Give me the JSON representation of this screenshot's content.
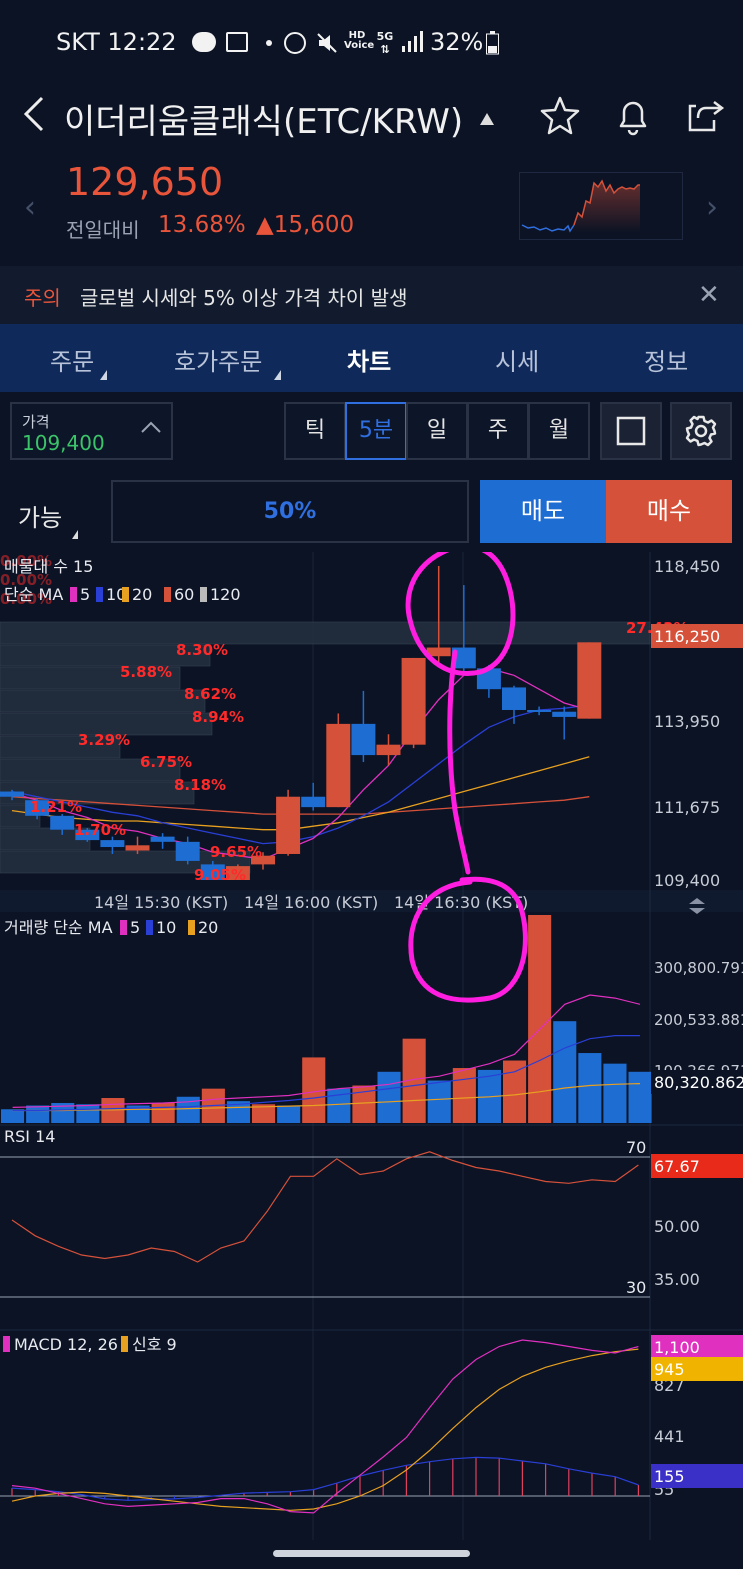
{
  "status": {
    "carrier_time": "SKT 12:22",
    "battery": "32%",
    "icons": [
      "talk-icon",
      "image-icon",
      "dot-icon",
      "alarm-icon",
      "mute-icon",
      "hd-voice-icon",
      "5g-icon",
      "signal-icon",
      "battery-icon"
    ]
  },
  "header": {
    "title": "이더리움클래식(ETC/KRW)",
    "icons": [
      "star-icon",
      "bell-icon",
      "share-icon"
    ]
  },
  "ticker": {
    "price": "129,650",
    "change_label": "전일대비",
    "change_pct": "13.68%",
    "change_amount": "▲15,600"
  },
  "notice": {
    "tag": "주의",
    "text": "글로벌 시세와 5% 이상 가격 차이 발생"
  },
  "tabs": [
    {
      "label": "주문"
    },
    {
      "label": "호가주문"
    },
    {
      "label": "차트"
    },
    {
      "label": "시세"
    },
    {
      "label": "정보"
    }
  ],
  "pricebox": {
    "label": "가격",
    "value": "109,400"
  },
  "periods": [
    "틱",
    "5분",
    "일",
    "주",
    "월"
  ],
  "active_period": "5분",
  "order": {
    "available_label": "가능",
    "percent": "50%",
    "sell_label": "매도",
    "buy_label": "매수"
  },
  "colors": {
    "up": "#d6513a",
    "down": "#1e6dd2",
    "accent_green": "#3cc46a",
    "annotation": "#ff1ee0"
  },
  "chart_data": {
    "type": "candlestick",
    "main_panel": {
      "title": "매물대 수 15",
      "ma_label": "단순 MA",
      "ma_periods": [
        "5",
        "10",
        "20",
        "60",
        "120"
      ],
      "y_ticks": [
        "118,450",
        "116,250",
        "113,950",
        "111,675",
        "109,400"
      ],
      "current_price_tag": "116,250",
      "top_left_labels": [
        "0.00%",
        "0.00%",
        "0.00%"
      ],
      "volume_profile_labels": [
        "8.30%",
        "5.88%",
        "8.62%",
        "8.94%",
        "3.29%",
        "6.75%",
        "8.18%",
        "1.21%",
        "1.70%",
        "9.65%",
        "9.05%"
      ],
      "edge_label": "27.43%",
      "x_ticks": [
        "14일 15:30 (KST)",
        "14일 16:00 (KST)",
        "14일 16:30 (KST)"
      ],
      "candles": [
        {
          "o": 111950,
          "h": 112000,
          "l": 111700,
          "c": 111800
        },
        {
          "o": 111700,
          "h": 111750,
          "l": 111150,
          "c": 111250
        },
        {
          "o": 111250,
          "h": 111300,
          "l": 110700,
          "c": 110850
        },
        {
          "o": 110850,
          "h": 110900,
          "l": 110500,
          "c": 110550
        },
        {
          "o": 110550,
          "h": 110650,
          "l": 110150,
          "c": 110350
        },
        {
          "o": 110250,
          "h": 110650,
          "l": 110150,
          "c": 110400
        },
        {
          "o": 110650,
          "h": 110750,
          "l": 110300,
          "c": 110500
        },
        {
          "o": 110500,
          "h": 110650,
          "l": 109850,
          "c": 109950
        },
        {
          "o": 109850,
          "h": 109950,
          "l": 109400,
          "c": 109400
        },
        {
          "o": 109400,
          "h": 109850,
          "l": 109400,
          "c": 109800
        },
        {
          "o": 109850,
          "h": 110200,
          "l": 109700,
          "c": 110100
        },
        {
          "o": 110150,
          "h": 112000,
          "l": 110100,
          "c": 111800
        },
        {
          "o": 111800,
          "h": 112200,
          "l": 111400,
          "c": 111500
        },
        {
          "o": 111500,
          "h": 114200,
          "l": 111500,
          "c": 113900
        },
        {
          "o": 113900,
          "h": 114850,
          "l": 112800,
          "c": 113000
        },
        {
          "o": 113000,
          "h": 113600,
          "l": 112700,
          "c": 113300
        },
        {
          "o": 113300,
          "h": 115800,
          "l": 113200,
          "c": 115800
        },
        {
          "o": 115850,
          "h": 118450,
          "l": 115600,
          "c": 116100
        },
        {
          "o": 116100,
          "h": 117900,
          "l": 115350,
          "c": 115500
        },
        {
          "o": 115500,
          "h": 115600,
          "l": 114650,
          "c": 114900
        },
        {
          "o": 114950,
          "h": 115000,
          "l": 113900,
          "c": 114300
        },
        {
          "o": 114300,
          "h": 114400,
          "l": 114150,
          "c": 114250
        },
        {
          "o": 114250,
          "h": 114400,
          "l": 113450,
          "c": 114100
        },
        {
          "o": 114050,
          "h": 116250,
          "l": 114050,
          "c": 116250
        }
      ],
      "ma5": [
        111900,
        111700,
        111400,
        111200,
        110900,
        110800,
        110600,
        110450,
        110200,
        110100,
        110000,
        110300,
        110600,
        111200,
        112000,
        112700,
        113700,
        114600,
        115300,
        115500,
        115300,
        114900,
        114500,
        114300
      ],
      "ma10": [
        111950,
        111800,
        111650,
        111500,
        111350,
        111250,
        111050,
        110900,
        110750,
        110600,
        110450,
        110500,
        110650,
        110900,
        111250,
        111650,
        112200,
        112750,
        113300,
        113800,
        114100,
        114300,
        114350,
        114450
      ],
      "ma20": [
        111400,
        111300,
        111200,
        111150,
        111100,
        111100,
        111050,
        111000,
        110950,
        110900,
        110850,
        110850,
        110950,
        111050,
        111200,
        111350,
        111550,
        111750,
        111950,
        112150,
        112350,
        112550,
        112750,
        112950
      ],
      "ma60": [
        111800,
        111750,
        111700,
        111650,
        111600,
        111550,
        111500,
        111450,
        111400,
        111350,
        111300,
        111300,
        111300,
        111300,
        111300,
        111350,
        111400,
        111450,
        111500,
        111550,
        111600,
        111650,
        111700,
        111800
      ]
    },
    "volume_panel": {
      "title": "거래량 단순 MA",
      "ma_periods": [
        "5",
        "10",
        "20"
      ],
      "y_ticks": [
        "300,800.791",
        "200,533.881",
        "100,266.971"
      ],
      "current_tag": "80,320.862",
      "values": [
        22000,
        28000,
        32000,
        30000,
        40000,
        28000,
        32000,
        42000,
        55000,
        35000,
        30000,
        28000,
        105000,
        55000,
        60000,
        82000,
        135000,
        68000,
        88000,
        85000,
        100000,
        333000,
        163000,
        112000,
        95000,
        82000,
        67000,
        48000,
        45000,
        60000,
        68000
      ]
    },
    "rsi_panel": {
      "title": "RSI 14",
      "y_ticks": [
        "70",
        "50.00",
        "35.00",
        "30"
      ],
      "current_tag": "67.67",
      "values": [
        52,
        47.5,
        44.5,
        42,
        41,
        42,
        44,
        43,
        40,
        44,
        46,
        54.5,
        64.5,
        64.5,
        69.5,
        65,
        66,
        69.5,
        71.5,
        69,
        67,
        66,
        64.5,
        63,
        62.5,
        63.5,
        63,
        67.7
      ]
    },
    "macd_panel": {
      "title": "MACD 12, 26",
      "signal_label": "신호 9",
      "y_ticks": [
        "827",
        "441",
        "55"
      ],
      "tags": [
        "1,100",
        "945",
        "155"
      ],
      "macd": [
        80,
        60,
        20,
        -20,
        -60,
        -80,
        -70,
        -60,
        -50,
        -20,
        -20,
        -60,
        -120,
        -130,
        20,
        160,
        300,
        450,
        680,
        900,
        1050,
        1150,
        1200,
        1180,
        1150,
        1120,
        1100,
        1150
      ],
      "signal": [
        -40,
        0,
        20,
        30,
        20,
        0,
        -20,
        -40,
        -60,
        -80,
        -90,
        -100,
        -110,
        -100,
        -60,
        0,
        80,
        200,
        350,
        520,
        680,
        820,
        920,
        990,
        1040,
        1080,
        1110,
        1130
      ],
      "hist": [
        110,
        90,
        60,
        20,
        -40,
        -60,
        -50,
        -40,
        -20,
        10,
        40,
        50,
        60,
        90,
        180,
        280,
        360,
        430,
        480,
        520,
        540,
        530,
        490,
        450,
        380,
        320,
        270,
        155
      ]
    }
  }
}
